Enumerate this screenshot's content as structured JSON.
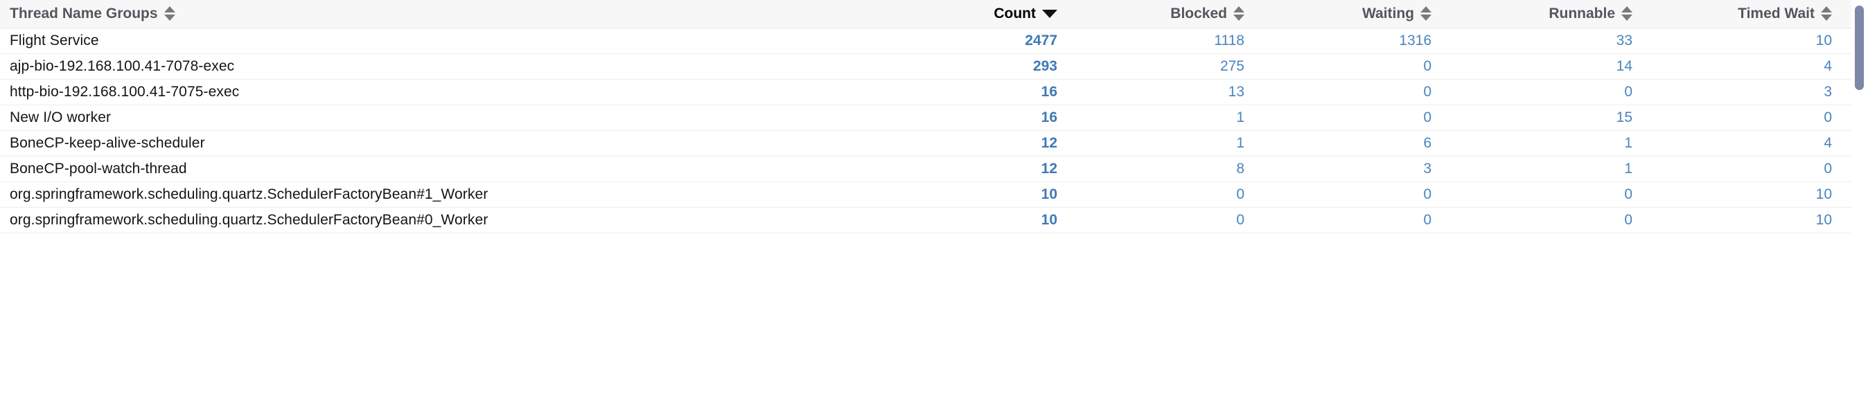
{
  "table": {
    "name": "thread-name-groups-table",
    "columns": [
      {
        "key": "name",
        "label": "Thread Name Groups",
        "align": "left",
        "sort_state": "none"
      },
      {
        "key": "count",
        "label": "Count",
        "align": "right",
        "sort_state": "desc"
      },
      {
        "key": "blocked",
        "label": "Blocked",
        "align": "right",
        "sort_state": "none"
      },
      {
        "key": "waiting",
        "label": "Waiting",
        "align": "right",
        "sort_state": "none"
      },
      {
        "key": "runnable",
        "label": "Runnable",
        "align": "right",
        "sort_state": "none"
      },
      {
        "key": "timedwait",
        "label": "Timed Wait",
        "align": "right",
        "sort_state": "none"
      }
    ],
    "rows": [
      {
        "name": "Flight Service",
        "count": "2477",
        "blocked": "1118",
        "waiting": "1316",
        "runnable": "33",
        "timedwait": "10"
      },
      {
        "name": "ajp-bio-192.168.100.41-7078-exec",
        "count": "293",
        "blocked": "275",
        "waiting": "0",
        "runnable": "14",
        "timedwait": "4"
      },
      {
        "name": "http-bio-192.168.100.41-7075-exec",
        "count": "16",
        "blocked": "13",
        "waiting": "0",
        "runnable": "0",
        "timedwait": "3"
      },
      {
        "name": "New I/O worker",
        "count": "16",
        "blocked": "1",
        "waiting": "0",
        "runnable": "15",
        "timedwait": "0"
      },
      {
        "name": "BoneCP-keep-alive-scheduler",
        "count": "12",
        "blocked": "1",
        "waiting": "6",
        "runnable": "1",
        "timedwait": "4"
      },
      {
        "name": "BoneCP-pool-watch-thread",
        "count": "12",
        "blocked": "8",
        "waiting": "3",
        "runnable": "1",
        "timedwait": "0"
      },
      {
        "name": "org.springframework.scheduling.quartz.SchedulerFactoryBean#1_Worker",
        "count": "10",
        "blocked": "0",
        "waiting": "0",
        "runnable": "0",
        "timedwait": "10"
      },
      {
        "name": "org.springframework.scheduling.quartz.SchedulerFactoryBean#0_Worker",
        "count": "10",
        "blocked": "0",
        "waiting": "0",
        "runnable": "0",
        "timedwait": "10"
      }
    ]
  },
  "icons": {
    "sort_neutral": "sort-both-icon",
    "sort_desc": "sort-descending-icon"
  },
  "colors": {
    "header_background": "#f7f7f8",
    "header_text": "#53565c",
    "header_text_active": "#000000",
    "row_text": "#121417",
    "number_text": "#4a84bd",
    "count_text": "#3f79b5",
    "row_divider": "#eeeef0",
    "scrollbar_thumb": "#7d88a8"
  },
  "scrollbar": {
    "name": "vertical-scrollbar",
    "orientation": "vertical"
  }
}
